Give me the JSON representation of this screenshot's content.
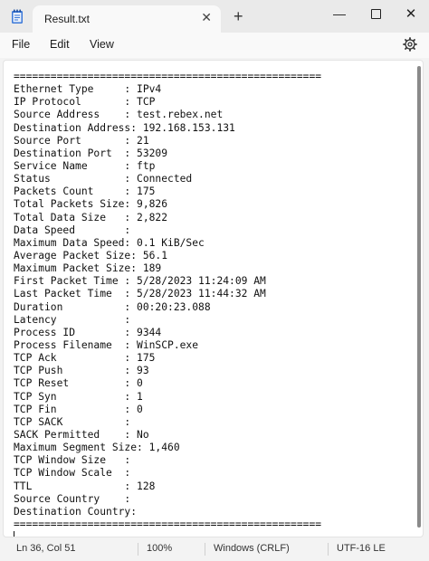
{
  "window": {
    "tab_title": "Result.txt",
    "tab_close": "✕",
    "new_tab": "+",
    "minimize": "—",
    "close": "✕"
  },
  "menu": {
    "file": "File",
    "edit": "Edit",
    "view": "View"
  },
  "icons": {
    "app": "notepad-icon",
    "settings": "gear-icon"
  },
  "document": {
    "lines": [
      "==================================================",
      "Ethernet Type     : IPv4",
      "IP Protocol       : TCP",
      "Source Address    : test.rebex.net",
      "Destination Address: 192.168.153.131",
      "Source Port       : 21",
      "Destination Port  : 53209",
      "Service Name      : ftp",
      "Status            : Connected",
      "Packets Count     : 175",
      "Total Packets Size: 9,826",
      "Total Data Size   : 2,822",
      "Data Speed        :",
      "Maximum Data Speed: 0.1 KiB/Sec",
      "Average Packet Size: 56.1",
      "Maximum Packet Size: 189",
      "First Packet Time : 5/28/2023 11:24:09 AM",
      "Last Packet Time  : 5/28/2023 11:44:32 AM",
      "Duration          : 00:20:23.088",
      "Latency           :",
      "Process ID        : 9344",
      "Process Filename  : WinSCP.exe",
      "TCP Ack           : 175",
      "TCP Push          : 93",
      "TCP Reset         : 0",
      "TCP Syn           : 1",
      "TCP Fin           : 0",
      "TCP SACK          :",
      "SACK Permitted    : No",
      "Maximum Segment Size: 1,460",
      "TCP Window Size   :",
      "TCP Window Scale  :",
      "TTL               : 128",
      "Source Country    :",
      "Destination Country:",
      "=================================================="
    ]
  },
  "status": {
    "position": "Ln 36, Col 51",
    "zoom": "100%",
    "line_ending": "Windows (CRLF)",
    "encoding": "UTF-16 LE"
  }
}
